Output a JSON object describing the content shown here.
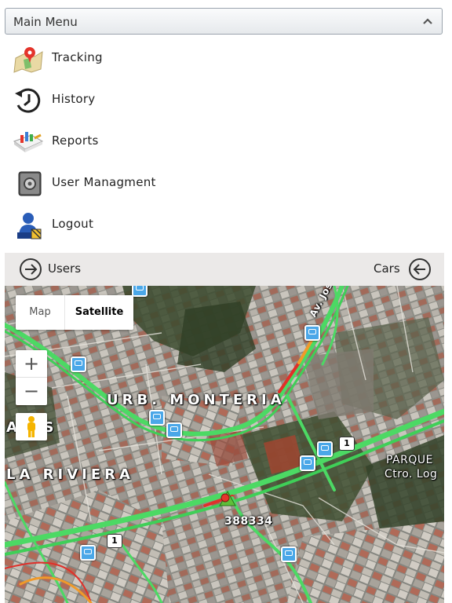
{
  "menu": {
    "title": "Main Menu",
    "items": [
      {
        "label": "Tracking",
        "icon": "map-pin-icon"
      },
      {
        "label": "History",
        "icon": "history-clock-icon"
      },
      {
        "label": "Reports",
        "icon": "reports-icon"
      },
      {
        "label": "User Managment",
        "icon": "user-management-icon"
      },
      {
        "label": "Logout",
        "icon": "logout-icon"
      }
    ]
  },
  "subbar": {
    "left_label": "Users",
    "right_label": "Cars"
  },
  "map": {
    "type_options": {
      "map": "Map",
      "satellite": "Satellite"
    },
    "selected_type": "Satellite",
    "zoom_in": "+",
    "zoom_out": "−",
    "labels": {
      "urb": "URB. MONTERIA",
      "aes": "A  ES",
      "riviera": "LA RIVIERA",
      "parque": "PARQUE",
      "ctro": "Ctro. Log",
      "av": "Av. Jos"
    },
    "shields": [
      "1",
      "1"
    ],
    "vehicle_id": "388334",
    "colors": {
      "traffic_green": "#4cd964",
      "traffic_red": "#e0302a",
      "traffic_orange": "#f09a2a",
      "bus_blue": "#4aa7e8"
    }
  }
}
